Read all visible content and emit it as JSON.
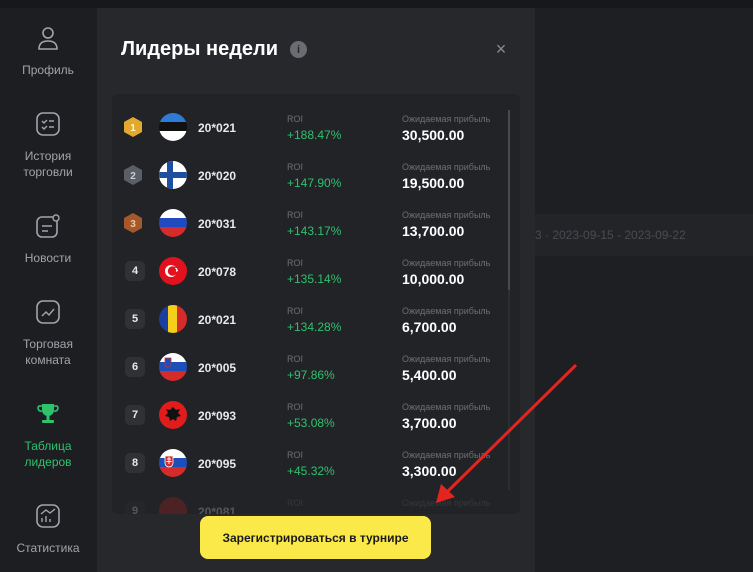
{
  "sidebar": {
    "items": [
      {
        "label": "Профиль",
        "icon": "user-icon"
      },
      {
        "label": "История торговли",
        "icon": "history-icon"
      },
      {
        "label": "Новости",
        "icon": "news-icon"
      },
      {
        "label": "Торговая комната",
        "icon": "chart-icon"
      },
      {
        "label": "Таблица лидеров",
        "icon": "trophy-icon",
        "active": true
      },
      {
        "label": "Статистика",
        "icon": "statistics-icon"
      }
    ]
  },
  "background": {
    "dates": "3  ·  2023-09-15  -  2023-09-22"
  },
  "modal": {
    "title": "Лидеры недели",
    "close": "×",
    "info": "i",
    "roi_label": "ROI",
    "profit_label": "Ожидаемая прибыль",
    "rows": [
      {
        "rank": "1",
        "user": "20*021",
        "country": "estonia-flag",
        "roi": "+188.47%",
        "profit": "30,500.00"
      },
      {
        "rank": "2",
        "user": "20*020",
        "country": "finland-flag",
        "roi": "+147.90%",
        "profit": "19,500.00"
      },
      {
        "rank": "3",
        "user": "20*031",
        "country": "russia-flag",
        "roi": "+143.17%",
        "profit": "13,700.00"
      },
      {
        "rank": "4",
        "user": "20*078",
        "country": "turkey-flag",
        "roi": "+135.14%",
        "profit": "10,000.00"
      },
      {
        "rank": "5",
        "user": "20*021",
        "country": "romania-flag",
        "roi": "+134.28%",
        "profit": "6,700.00"
      },
      {
        "rank": "6",
        "user": "20*005",
        "country": "slovenia-flag",
        "roi": "+97.86%",
        "profit": "5,400.00"
      },
      {
        "rank": "7",
        "user": "20*093",
        "country": "albania-flag",
        "roi": "+53.08%",
        "profit": "3,700.00"
      },
      {
        "rank": "8",
        "user": "20*095",
        "country": "slovakia-flag",
        "roi": "+45.32%",
        "profit": "3,300.00"
      },
      {
        "rank": "9",
        "user": "20*081",
        "country": "flag",
        "roi": "",
        "profit": ""
      }
    ],
    "cta": "Зарегистрироваться в турнире"
  },
  "colors": {
    "accent_green": "#2ec26d",
    "cta_yellow": "#fbe94a",
    "annotation_red": "#e52420"
  }
}
